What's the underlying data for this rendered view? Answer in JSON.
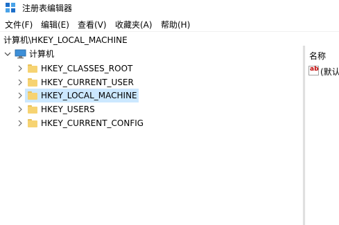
{
  "window": {
    "title": "注册表编辑器"
  },
  "menu": {
    "file": "文件(F)",
    "edit": "编辑(E)",
    "view": "查看(V)",
    "favorites": "收藏夹(A)",
    "help": "帮助(H)"
  },
  "address": {
    "path": "计算机\\HKEY_LOCAL_MACHINE"
  },
  "tree": {
    "root": "计算机",
    "keys": [
      {
        "label": "HKEY_CLASSES_ROOT"
      },
      {
        "label": "HKEY_CURRENT_USER"
      },
      {
        "label": "HKEY_LOCAL_MACHINE",
        "selected": true
      },
      {
        "label": "HKEY_USERS"
      },
      {
        "label": "HKEY_CURRENT_CONFIG"
      }
    ]
  },
  "values_pane": {
    "column_name": "名称",
    "rows": [
      {
        "icon": "string-value-icon",
        "icon_text": "ab",
        "name": "(默认"
      }
    ]
  },
  "colors": {
    "selection": "#cce8ff",
    "folder": "#f6d372"
  }
}
